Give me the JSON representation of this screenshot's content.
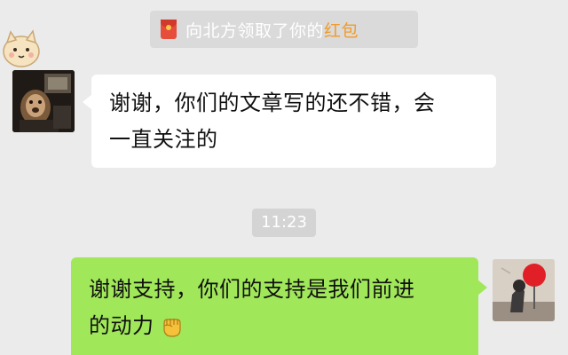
{
  "system_notice": {
    "icon": "red-packet-icon",
    "text_prefix": "向北方领取了你的",
    "text_highlight": "红包",
    "highlight_color": "#f19b27"
  },
  "messages": [
    {
      "direction": "incoming",
      "line1": "谢谢，你们的文章写的还不错，会",
      "line2": "一直关注的",
      "bubble_color": "#ffffff"
    },
    {
      "direction": "outgoing",
      "line1": "谢谢支持，你们的支持是我们前进",
      "line2": "的动力",
      "emoji": "raised-fist-emoji",
      "bubble_color": "#a0e759"
    }
  ],
  "timestamp": "11:23",
  "colors": {
    "background": "#ebebeb",
    "notice_bg": "#dadada",
    "outgoing_bubble": "#a0e759",
    "incoming_bubble": "#ffffff",
    "red_packet": "#e74d3b"
  }
}
